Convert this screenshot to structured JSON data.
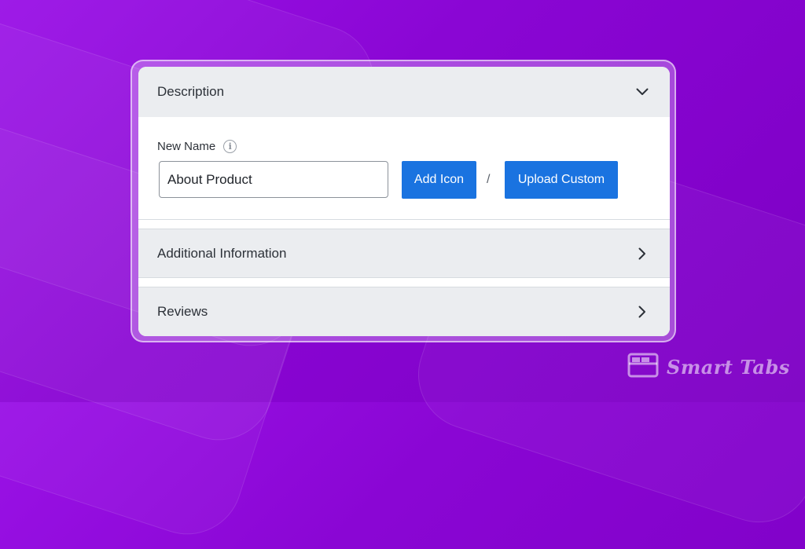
{
  "accordion": {
    "sections": [
      {
        "title": "Description",
        "expanded": true,
        "chevron_icon": "chevron-down-icon"
      },
      {
        "title": "Additional Information",
        "expanded": false,
        "chevron_icon": "chevron-right-icon"
      },
      {
        "title": "Reviews",
        "expanded": false,
        "chevron_icon": "chevron-right-icon"
      }
    ]
  },
  "form": {
    "field_label": "New Name",
    "info_icon": "info-icon",
    "name_value": "About Product",
    "add_icon_label": "Add Icon",
    "separator": "/",
    "upload_custom_label": "Upload Custom"
  },
  "brand": {
    "logo_icon": "tabs-window-icon",
    "name": "Smart Tabs"
  },
  "colors": {
    "background": "#8a06d4",
    "accent_button": "#1a73e0",
    "header_bg": "#ebedf0"
  }
}
